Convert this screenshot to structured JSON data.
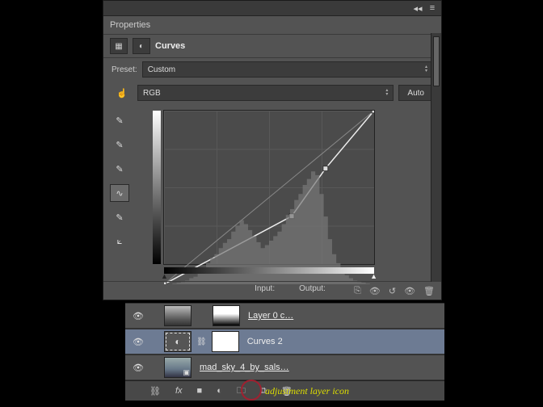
{
  "panel": {
    "title": "Properties",
    "adjustment_label": "Curves",
    "preset_label": "Preset:",
    "preset_value": "Custom",
    "channel_value": "RGB",
    "auto_label": "Auto",
    "input_label": "Input:",
    "output_label": "Output:"
  },
  "chart_data": {
    "type": "line",
    "title": "Curves",
    "xlabel": "Input",
    "ylabel": "Output",
    "xlim": [
      0,
      255
    ],
    "ylim": [
      0,
      255
    ],
    "series": [
      {
        "name": "curve",
        "x": [
          0,
          155,
          196,
          255
        ],
        "y": [
          0,
          100,
          170,
          255
        ]
      }
    ],
    "histogram": [
      0,
      0,
      1,
      2,
      3,
      5,
      8,
      10,
      14,
      20,
      28,
      35,
      40,
      48,
      55,
      60,
      70,
      78,
      85,
      80,
      72,
      64,
      56,
      48,
      52,
      58,
      64,
      70,
      80,
      92,
      100,
      112,
      120,
      132,
      140,
      150,
      145,
      120,
      90,
      60,
      40,
      28,
      18,
      12,
      8,
      5,
      3,
      2,
      1,
      0
    ]
  },
  "layers": {
    "items": [
      {
        "name": "Layer 0 c…",
        "type": "photo-with-mask"
      },
      {
        "name": "Curves 2",
        "type": "adjustment"
      },
      {
        "name": "mad_sky_4_by_sals…",
        "type": "smart-object"
      }
    ]
  },
  "annotation": {
    "text": "adjustment layer icon"
  },
  "icons": {
    "collapse": "◂◂",
    "menu": "≡",
    "adj_square": "▦",
    "adj_circle": "◐",
    "dropdown_up": "▴",
    "dropdown_down": "▾",
    "hand_white": "☝",
    "dropper": "✎",
    "curve": "∿",
    "pencil": "✎",
    "reflect": "⟀",
    "clip": "⎘",
    "eye": "👁",
    "reset": "↺",
    "trash": "🗑",
    "link": "⛓",
    "fx": "fx",
    "mask": "■",
    "new_adj": "◐",
    "folder": "🗀",
    "new_layer": "⧉"
  }
}
